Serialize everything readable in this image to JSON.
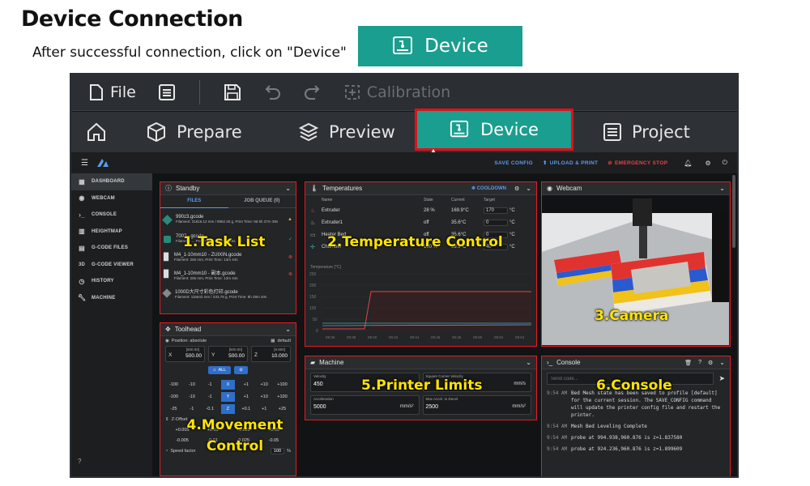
{
  "header": {
    "title": "Device Connection",
    "subtitle": "After successful connection, click on \"Device\"",
    "device_button": "Device"
  },
  "toolbar": {
    "file_label": "File",
    "calibration_label": "Calibration"
  },
  "nav": {
    "prepare": "Prepare",
    "preview": "Preview",
    "device": "Device",
    "project": "Project"
  },
  "topbar": {
    "save_config": "SAVE CONFIG",
    "upload_print": "UPLOAD & PRINT",
    "emergency_stop": "EMERGENCY STOP"
  },
  "sidebar": {
    "items": [
      {
        "label": "DASHBOARD",
        "icon": "dashboard-icon"
      },
      {
        "label": "WEBCAM",
        "icon": "webcam-icon"
      },
      {
        "label": "CONSOLE",
        "icon": "console-icon"
      },
      {
        "label": "HEIGHTMAP",
        "icon": "heightmap-icon"
      },
      {
        "label": "G-CODE FILES",
        "icon": "file-icon"
      },
      {
        "label": "G-CODE VIEWER",
        "icon": "3d-icon"
      },
      {
        "label": "HISTORY",
        "icon": "history-icon"
      },
      {
        "label": "MACHINE",
        "icon": "wrench-icon"
      }
    ],
    "icon_3d": "3D"
  },
  "standby": {
    "title": "Standby",
    "tab_files": "FILES",
    "tab_queue": "JOB QUEUE (0)",
    "files": [
      {
        "name": "990z3.gcode",
        "meta": "Filament: 31816.12 mm / 8952.30 g, Print Time: 9d 6h 37m 39s"
      },
      {
        "name": "7002...gcode",
        "meta": "Filament: ... Print Time: 10h 21m 26s"
      },
      {
        "name": "M4_1-10mm10 - ZUIXIN.gcode",
        "meta": "Filament: 265 mm, Print Time: 13m 44s"
      },
      {
        "name": "M4_1-10mm10 - 副本.gcode",
        "meta": "Filament: 265 mm, Print Time: 13m 44s"
      },
      {
        "name": "1000D大尺寸彩色打印.gcode",
        "meta": "Filament: 115643 mm / 333.78 g, Print Time: 8h 29m 40s"
      }
    ]
  },
  "temperatures": {
    "title": "Temperatures",
    "cooldown": "COOLDOWN",
    "cols": {
      "name": "Name",
      "state": "State",
      "current": "Current",
      "target": "Target"
    },
    "rows": [
      {
        "name": "Extruder",
        "state": "28 %",
        "current": "169.9°C",
        "target": "170",
        "unit": "°C"
      },
      {
        "name": "Extruder1",
        "state": "off",
        "current": "35.6°C",
        "target": "0",
        "unit": "°C"
      },
      {
        "name": "Heater Bed",
        "state": "off",
        "current": "35.6°C",
        "target": "0",
        "unit": "°C"
      },
      {
        "name": "Chamber",
        "state": "100 %",
        "current": "39.9°C",
        "target": "40",
        "unit": "°C"
      }
    ],
    "graph_label": "Temperature [°C]",
    "y_ticks": [
      "250",
      "200",
      "150",
      "100",
      "50",
      "0"
    ],
    "x_ticks": [
      "09:36",
      "09:38",
      "09:40",
      "09:42",
      "09:44",
      "09:46",
      "09:48",
      "09:50",
      "09:52",
      "09:54"
    ]
  },
  "webcam": {
    "title": "Webcam"
  },
  "toolhead": {
    "title": "Toolhead",
    "position_label": "Position: absolute",
    "default_label": "default",
    "axes": [
      {
        "label": "X",
        "value": "500.00",
        "max": "[500.00]"
      },
      {
        "label": "Y",
        "value": "500.00",
        "max": "[500.00]"
      },
      {
        "label": "Z",
        "value": "10.000",
        "max": "[9.900]"
      }
    ],
    "all_button": "ALL",
    "move_rows": [
      [
        "-100",
        "-10",
        "-1",
        "X",
        "+1",
        "+10",
        "+100"
      ],
      [
        "-100",
        "-10",
        "-1",
        "Y",
        "+1",
        "+10",
        "+100"
      ],
      [
        "-25",
        "-1",
        "-0.1",
        "Z",
        "+0.1",
        "+1",
        "+25"
      ]
    ],
    "zoffset_label": "Z-Offset",
    "zoff_rows": [
      [
        "+0.005",
        "+0.01",
        "+0.025",
        "+0.05"
      ],
      [
        "-0.005",
        "-0.01",
        "-0.025",
        "-0.05"
      ]
    ],
    "speed_label": "Speed factor",
    "speed_value": "100",
    "speed_unit": "%"
  },
  "machine": {
    "title": "Machine",
    "fields": [
      {
        "label": "Velocity",
        "value": "450",
        "unit": "mm/s"
      },
      {
        "label": "Square Corner Velocity",
        "value": "5",
        "unit": "mm/s"
      },
      {
        "label": "Acceleration",
        "value": "5000",
        "unit": "mm/s²"
      },
      {
        "label": "Max Accel. to Decel.",
        "value": "2500",
        "unit": "mm/s²"
      }
    ]
  },
  "console": {
    "title": "Console",
    "placeholder": "Send code...",
    "lines": [
      {
        "time": "9:54 AM",
        "text": "Bed Mesh state has been saved to profile [default] for the current session. The SAVE_CONFIG command will update the printer config file and restart the printer."
      },
      {
        "time": "9:54 AM",
        "text": "Mesh Bed Leveling Complete"
      },
      {
        "time": "9:54 AM",
        "text": "probe at 994.938,960.876 is z=1.837580"
      },
      {
        "time": "9:54 AM",
        "text": "probe at 924.236,960.876 is z=1.899609"
      }
    ]
  },
  "annotations": {
    "task_list": "1.Task List",
    "temp_control": "2.Temperature Control",
    "camera": "3.Camera",
    "movement": "4.Movement Control",
    "limits": "5.Printer Limits",
    "console": "6.Console"
  },
  "colors": {
    "accent": "#1a9e8f",
    "highlight": "#e0101a",
    "annotation": "#ffe400",
    "link": "#5b9be8"
  }
}
